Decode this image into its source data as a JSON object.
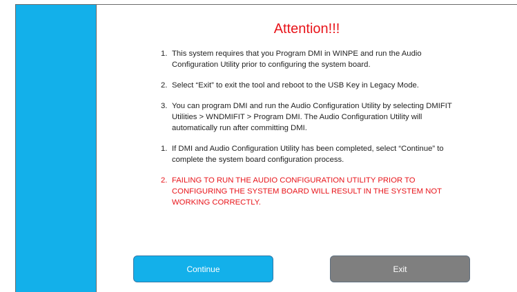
{
  "title": "Attention!!!",
  "items": [
    {
      "num": "1.",
      "text": "This system requires that you Program DMI in WINPE and run the Audio Configuration Utility prior to configuring the system board."
    },
    {
      "num": "2.",
      "text": "Select “Exit” to exit the tool and reboot to the USB Key in Legacy Mode."
    },
    {
      "num": "3.",
      "text": "You can program DMI and run the Audio Configuration Utility by selecting DMIFIT Utilities > WNDMIFIT > Program DMI.  The Audio Configuration Utility will automatically run after committing DMI."
    },
    {
      "num": "1.",
      "text": "If DMI and Audio Configuration Utility has been completed, select “Continue” to complete the system board configuration process."
    },
    {
      "num": "2.",
      "text": "FAILING TO RUN THE AUDIO CONFIGURATION UTILITY PRIOR TO CONFIGURING THE SYSTEM BOARD WILL RESULT IN THE SYSTEM NOT WORKING CORRECTLY."
    }
  ],
  "buttons": {
    "continue_label": "Continue",
    "exit_label": "Exit"
  },
  "colors": {
    "sidebar": "#13b0ea",
    "title": "#e8141a",
    "warning_text": "#e8141a",
    "continue_button": "#13b0ea",
    "exit_button": "#7f7f7f"
  }
}
